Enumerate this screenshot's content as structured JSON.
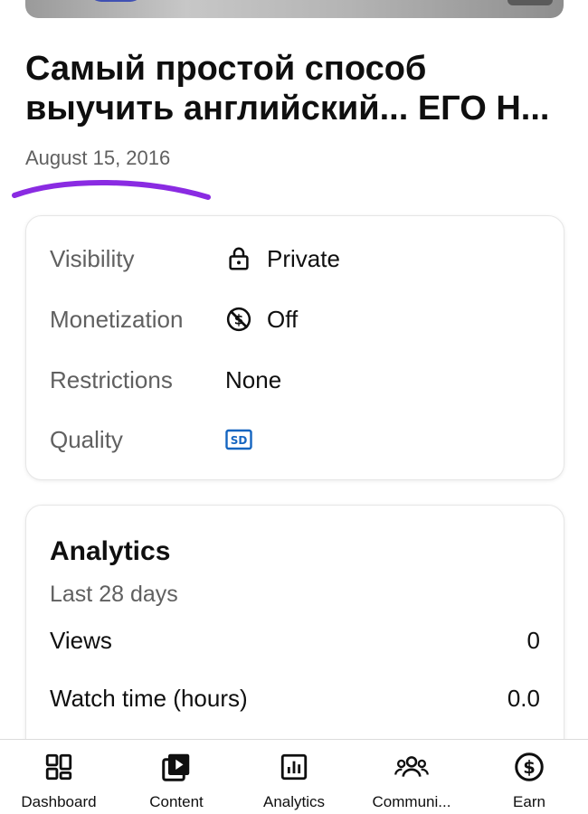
{
  "video": {
    "title": "Самый простой способ\nвыучить английский... ЕГО Н...",
    "date": "August 15, 2016"
  },
  "details": {
    "visibility": {
      "label": "Visibility",
      "value": "Private",
      "icon": "lock-icon"
    },
    "monetization": {
      "label": "Monetization",
      "value": "Off",
      "icon": "monetization-off-icon"
    },
    "restrictions": {
      "label": "Restrictions",
      "value": "None"
    },
    "quality": {
      "label": "Quality",
      "badge": "SD",
      "icon": "sd-badge-icon"
    }
  },
  "analytics": {
    "title": "Analytics",
    "period": "Last 28 days",
    "metrics": [
      {
        "label": "Views",
        "value": "0"
      },
      {
        "label": "Watch time (hours)",
        "value": "0.0"
      }
    ]
  },
  "nav": [
    {
      "label": "Dashboard",
      "icon": "dashboard-icon"
    },
    {
      "label": "Content",
      "icon": "content-icon"
    },
    {
      "label": "Analytics",
      "icon": "analytics-icon"
    },
    {
      "label": "Communi...",
      "icon": "community-icon"
    },
    {
      "label": "Earn",
      "icon": "earn-icon"
    }
  ],
  "colors": {
    "annotation_stroke": "#8a2be2",
    "quality_badge": "#1565c0"
  }
}
